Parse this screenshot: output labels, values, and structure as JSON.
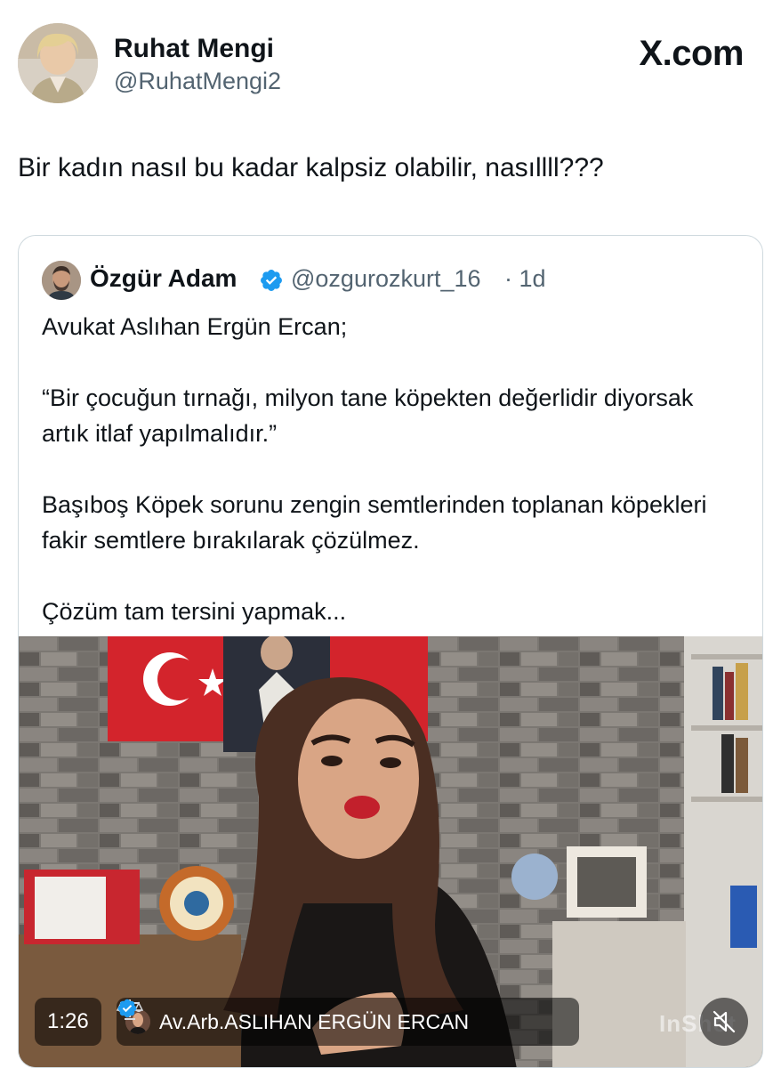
{
  "tweet": {
    "author_name": "Ruhat Mengi",
    "author_handle": "@RuhatMengi2",
    "brand": "X.com",
    "text": "Bir kadın nasıl bu kadar kalpsiz olabilir, nasıllll???"
  },
  "quote": {
    "author_name": "Özgür Adam",
    "author_handle": "@ozgurozkurt_16",
    "time": "· 1d",
    "paragraphs": [
      "Avukat Aslıhan Ergün Ercan;",
      "“Bir çocuğun tırnağı, milyon tane köpekten değerlidir diyorsak artık itlaf yapılmalıdır.”",
      "Başıboş Köpek sorunu zengin semtlerinden toplanan köpekleri fakir semtlere bırakılarak çözülmez.",
      "Çözüm tam tersini yapmak..."
    ]
  },
  "video": {
    "duration": "1:26",
    "channel_name": "Av.Arb.ASLIHAN ERGÜN ERCAN",
    "watermark": "InShot"
  },
  "icons": {
    "verified": "verified-badge-icon",
    "scales": "scales-of-justice-icon",
    "mute": "muted-speaker-icon"
  },
  "colors": {
    "verified_blue": "#1d9bf0",
    "handle_gray": "#536471",
    "text": "#0f1419",
    "border": "#cfd9de",
    "flag_red": "#d3242c"
  }
}
